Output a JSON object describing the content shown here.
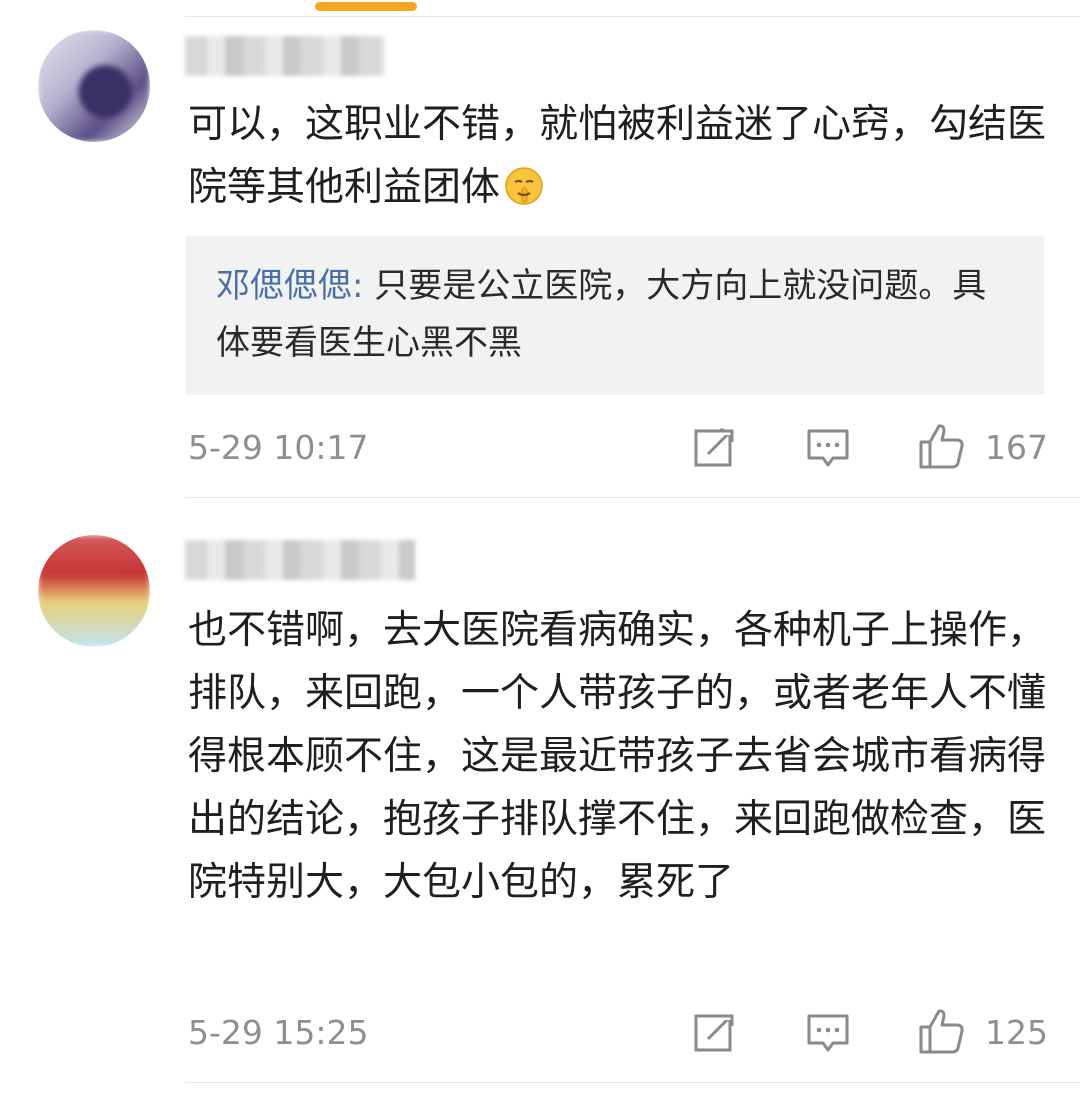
{
  "comments": [
    {
      "text": "可以，这职业不错，就怕被利益迷了心窍，勾结医院等其他利益团体",
      "emoji_icon": "shushing-face-icon",
      "reply": {
        "name": "邓偲偲偲",
        "separator": ":",
        "text": " 只要是公立医院，大方向上就没问题。具体要看医生心黑不黑"
      },
      "time": "5-29 10:17",
      "likes": "167"
    },
    {
      "text": "也不错啊，去大医院看病确实，各种机子上操作，排队，来回跑，一个人带孩子的，或者老年人不懂得根本顾不住，这是最近带孩子去省会城市看病得出的结论，抱孩子排队撑不住，来回跑做检查，医院特别大，大包小包的，累死了",
      "time": "5-29 15:25",
      "likes": "125"
    }
  ],
  "icons": {
    "share": "share-icon",
    "comment": "comment-icon",
    "like": "thumbs-up-icon"
  },
  "colors": {
    "accent_bar": "#f6a623",
    "reply_name": "#4a6fa5",
    "meta": "#8f8f8f"
  }
}
